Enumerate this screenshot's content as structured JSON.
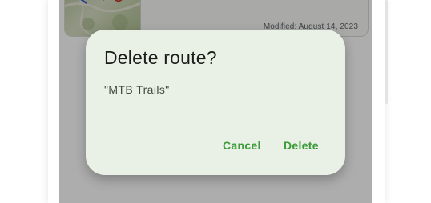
{
  "route_card": {
    "modified_label": "Modified:",
    "modified_date": "August 14, 2023"
  },
  "dialog": {
    "title": "Delete route?",
    "message": "\"MTB Trails\"",
    "cancel_label": "Cancel",
    "delete_label": "Delete"
  },
  "colors": {
    "dialog_bg": "#e9f1e7",
    "accent_button": "#3d9b3a",
    "scrim": "rgba(0,0,0,0.32)"
  }
}
